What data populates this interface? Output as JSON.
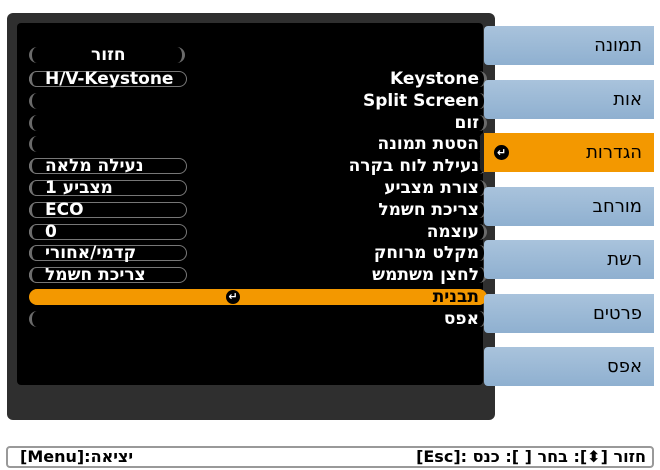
{
  "tabs": [
    {
      "label": "תמונה"
    },
    {
      "label": "אות"
    },
    {
      "label": "הגדרות",
      "icon": "enter-icon"
    },
    {
      "label": "מורחב"
    },
    {
      "label": "רשת"
    },
    {
      "label": "פרטים"
    },
    {
      "label": "אפס"
    }
  ],
  "menu": {
    "back_label": "חזור",
    "rows": [
      {
        "name": "Keystone",
        "value": "H/V-Keystone"
      },
      {
        "name": "Split Screen",
        "value": ""
      },
      {
        "name": "זום",
        "value": ""
      },
      {
        "name": "הסטת תמונה",
        "value": ""
      },
      {
        "name": "נעילת לוח בקרה",
        "value": "נעילה מלאה"
      },
      {
        "name": "צורת מצביע",
        "value": "מצביע 1"
      },
      {
        "name": "צריכת חשמל",
        "value": "ECO"
      },
      {
        "name": "עוצמה",
        "value": "0"
      },
      {
        "name": "מקלט מרוחק",
        "value": "קדמי/אחורי"
      },
      {
        "name": "לחצן משתמש",
        "value": "צריכת חשמל"
      },
      {
        "name": "תבנית",
        "value": "",
        "selected": true
      },
      {
        "name": "אפס",
        "value": ""
      }
    ]
  },
  "helpbar": {
    "right": "[Esc]: חזור [⬍]: בחר [ ]: כנס",
    "left": "[Menu]:יציאה"
  },
  "colors": {
    "accent": "#f39800",
    "tab_bg": "#a9c3dc",
    "panel_bg": "#000000"
  }
}
